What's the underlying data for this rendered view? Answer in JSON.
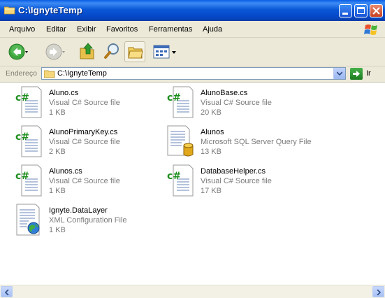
{
  "window": {
    "title": "C:\\IgnyteTemp"
  },
  "menu": [
    "Arquivo",
    "Editar",
    "Exibir",
    "Favoritos",
    "Ferramentas",
    "Ajuda"
  ],
  "address": {
    "label": "Endereço",
    "path": "C:\\IgnyteTemp",
    "go_label": "Ir"
  },
  "files": [
    {
      "name": "Aluno.cs",
      "type": "Visual C# Source file",
      "size": "1 KB",
      "icon": "csharp-file-icon"
    },
    {
      "name": "AlunoBase.cs",
      "type": "Visual C# Source file",
      "size": "20 KB",
      "icon": "csharp-file-icon"
    },
    {
      "name": "AlunoPrimaryKey.cs",
      "type": "Visual C# Source file",
      "size": "2 KB",
      "icon": "csharp-file-icon"
    },
    {
      "name": "Alunos",
      "type": "Microsoft SQL Server Query File",
      "size": "13 KB",
      "icon": "sql-query-file-icon"
    },
    {
      "name": "Alunos.cs",
      "type": "Visual C# Source file",
      "size": "1 KB",
      "icon": "csharp-file-icon"
    },
    {
      "name": "DatabaseHelper.cs",
      "type": "Visual C# Source file",
      "size": "17 KB",
      "icon": "csharp-file-icon"
    },
    {
      "name": "Ignyte.DataLayer",
      "type": "XML Configuration File",
      "size": "1 KB",
      "icon": "xml-config-file-icon"
    }
  ],
  "colors": {
    "titlebar": "#0a58d6",
    "chrome": "#ece9d8",
    "csharp_green": "#1f8f1f",
    "secondary_text": "#7a7a7a"
  }
}
